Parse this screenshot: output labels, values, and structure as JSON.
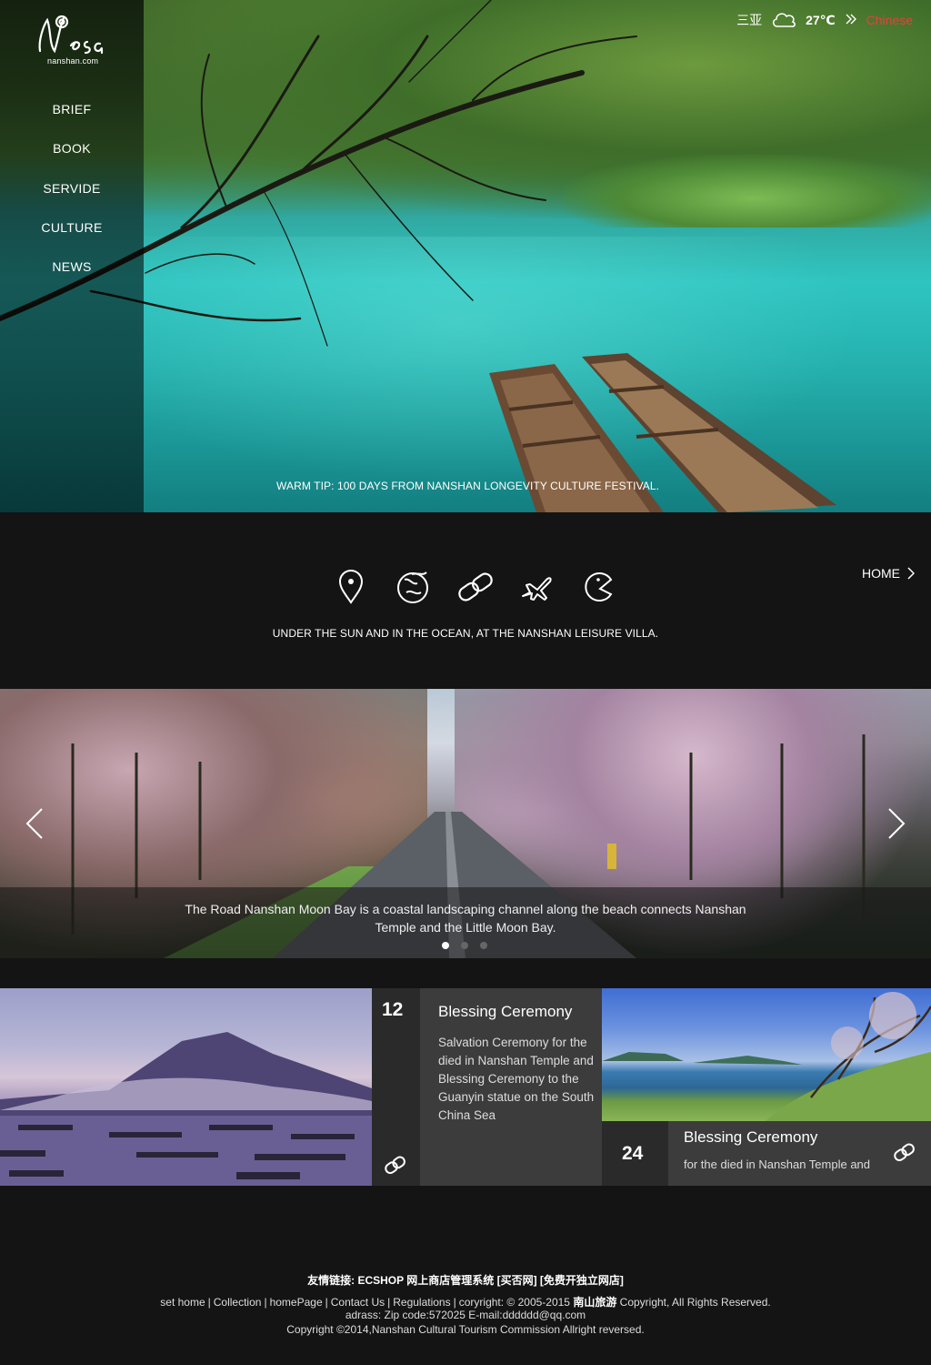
{
  "header": {
    "logo_text": "Nesa",
    "logo_sub": "nanshan.com",
    "city": "三亚",
    "weather_icon": "cloud-icon",
    "temperature": "27℃",
    "language": "Chinese",
    "nav": [
      {
        "label": "BRIEF"
      },
      {
        "label": "BOOK"
      },
      {
        "label": "SERVIDE"
      },
      {
        "label": "CULTURE"
      },
      {
        "label": "NEWS"
      }
    ],
    "warm_tip": "WARM TIP: 100 DAYS FROM NANSHAN LONGEVITY CULTURE FESTIVAL."
  },
  "iconbar": {
    "icons": [
      "location-pin-icon",
      "planet-icon",
      "link-icon",
      "airplane-icon",
      "pacman-icon"
    ],
    "home_label": "HOME",
    "tagline": "UNDER THE SUN AND IN THE OCEAN, AT THE NANSHAN LEISURE VILLA."
  },
  "slider": {
    "caption": "The Road Nanshan Moon Bay is a coastal landscaping channel along the beach connects Nanshan Temple and the Little Moon Bay.",
    "slide_count": 3,
    "active_slide": 1
  },
  "cards": [
    {
      "date": "12",
      "title": "Blessing Ceremony",
      "text": "Salvation Ceremony for the died in Nanshan Temple and Blessing Ceremony to the Guanyin statue on the South China Sea"
    },
    {
      "date": "24",
      "title": "Blessing Ceremony",
      "text": "for the died in Nanshan Temple and"
    }
  ],
  "footer": {
    "friends": "友情链接: ECSHOP 网上商店管理系统 [买否网] [免费开独立网店]",
    "links": [
      "set home",
      "Collection",
      "homePage",
      "Contact Us",
      "Regulations"
    ],
    "copyright_pre": "coryright: © 2005-2015 ",
    "brand": "南山旅游",
    "copyright_post": " Copyright, All Rights Reserved.",
    "address": "adrass: Zip code:572025 E-mail:dddddd@qq.com",
    "commission": "Copyright ©2014,Nanshan Cultural Tourism Commission Allright reversed."
  },
  "colors": {
    "accent": "#e8413b",
    "background": "#141414",
    "card_dark": "#2a2a2a",
    "card_mid": "#3c3c3c"
  }
}
